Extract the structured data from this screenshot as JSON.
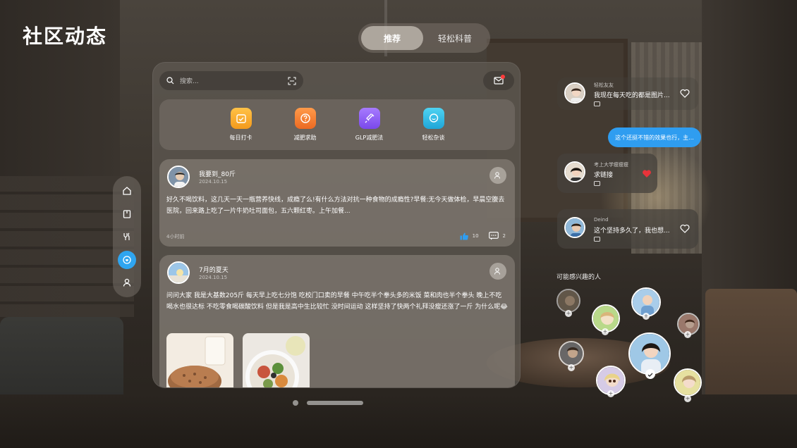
{
  "page": {
    "title": "社区动态"
  },
  "top_tabs": [
    {
      "label": "推荐",
      "active": true
    },
    {
      "label": "轻松科普",
      "active": false
    }
  ],
  "left_nav": [
    {
      "icon": "home-icon",
      "active": false
    },
    {
      "icon": "book-icon",
      "active": false
    },
    {
      "icon": "fork-knife-icon",
      "active": false
    },
    {
      "icon": "community-icon",
      "active": true
    },
    {
      "icon": "user-icon",
      "active": false
    }
  ],
  "search": {
    "placeholder": "搜索..."
  },
  "quick_actions": [
    {
      "label": "每日打卡",
      "icon": "calendar-check-icon",
      "color": "#f5a623"
    },
    {
      "label": "减肥求助",
      "icon": "question-icon",
      "color": "#f07a2f"
    },
    {
      "label": "GLP减肥法",
      "icon": "syringe-icon",
      "color": "#8a5cf0"
    },
    {
      "label": "轻松杂谈",
      "icon": "chat-icon",
      "color": "#2fb8e0"
    }
  ],
  "posts": [
    {
      "user": "我要到_80斤",
      "date": "2024.10.15",
      "body": "好久不喝饮料，这几天一天一瓶营养快线，成瘾了么!有什么方法对抗一种食物的成瘾性?早餐:无今天做体检，早晨空腹去医院，回来路上吃了一片牛奶吐司面包，五六颗红枣。上午加餐...",
      "time": "4小时前",
      "likes": "10",
      "comments": "2"
    },
    {
      "user": "7月的夏天",
      "date": "2024.10.15",
      "body": "问问大家 我是大基数205斤 每天早上吃七分饱 吃校门口卖的早餐 中午吃半个拳头多的米饭 菜和肉也半个拳头 晚上不吃 喝水也很达标 不吃零食喝碳酸饮料 但是我是高中生比较忙 没时间运动 这样坚持了快两个礼拜没瘦还涨了一斤 为什么呢😂"
    }
  ],
  "chats": [
    {
      "name": "轻松友友",
      "message": "我现在每天吃的都是图片..."
    },
    {
      "bubble": "这个还挺不错的效果也行，主..."
    },
    {
      "name": "考上大学瘦瘦瘦",
      "message": "求链接"
    },
    {
      "name": "Deind",
      "message": "这个坚持多久了，我也想..."
    }
  ],
  "interest": {
    "label": "可能感兴趣的人"
  },
  "colors": {
    "accent": "#2fa5f0",
    "like": "#2f9df0",
    "heart": "#e8333a"
  }
}
